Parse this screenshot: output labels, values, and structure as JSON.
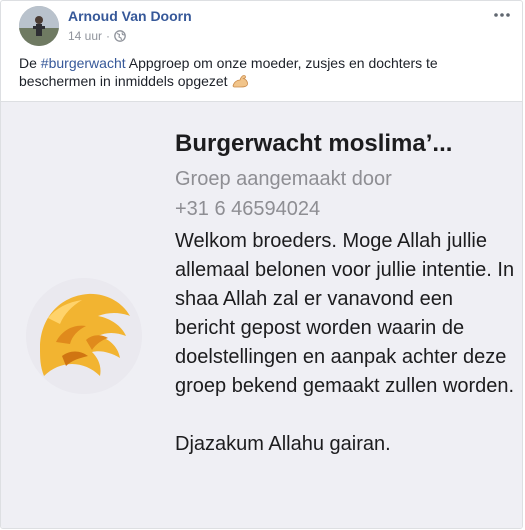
{
  "post": {
    "author": "Arnoud Van Doorn",
    "time": "14 uur",
    "separator": "·",
    "privacy_icon": "globe-icon",
    "more_icon": "more-options-icon",
    "text_prefix": "De ",
    "hashtag": "#burgerwacht",
    "text_suffix": " Appgroep om onze moeder, zusjes en dochters te beschermen in inmiddels opgezet",
    "emoji": "flexed-biceps-icon"
  },
  "shared_screenshot": {
    "group_title": "Burgerwacht moslima’...",
    "created_by": "Groep aangemaakt door",
    "phone": "+31 6 46594024",
    "message": "Welkom broeders. Moge Allah jullie allemaal belonen voor jullie intentie. In shaa Allah zal er vanavond een bericht gepost worden waarin de doelstellingen en aanpak achter deze groep bekend gemaakt zullen worden.",
    "signoff": "Djazakum Allahu gairan.",
    "logo_icon": "lion-head-icon"
  },
  "colors": {
    "link": "#365899",
    "meta": "#90949c",
    "text": "#1d2129",
    "screenshot_bg": "#efeff4",
    "logo_gold": "#f2b431"
  }
}
